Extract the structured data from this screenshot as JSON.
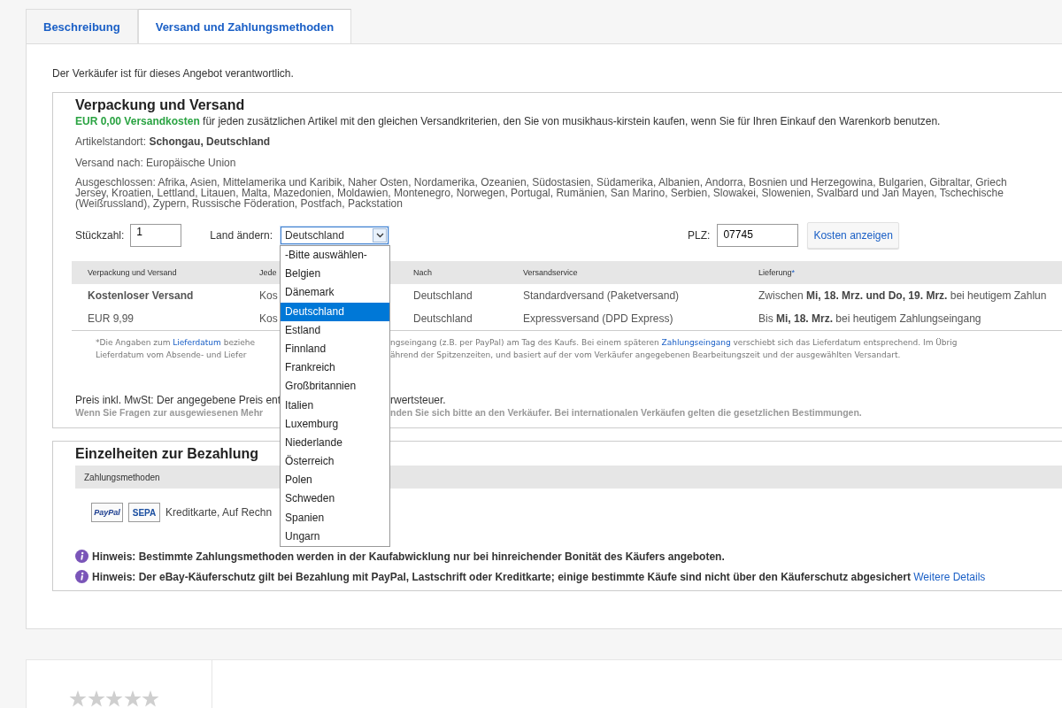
{
  "tabs": [
    {
      "label": "Beschreibung",
      "selected": false
    },
    {
      "label": "Versand und Zahlungsmethoden",
      "selected": true
    }
  ],
  "responsibility": "Der Verkäufer ist für dieses Angebot verantwortlich.",
  "shipping": {
    "title": "Verpackung und Versand",
    "extra_cost": "**EUR 0,00 Versandkosten** für jeden zusätzlichen Artikel mit den gleichen Versandkriterien, den Sie von musikhaus-kirstein kaufen, wenn Sie für Ihren Einkauf den Warenkorb benutzen.",
    "location": "Artikelstandort: **Schongau, Deutschland**",
    "ship_to": "Versand nach: Europäische Union",
    "excluded_lines": [
      "Ausgeschlossen: Afrika, Asien, Mittelamerika und Karibik, Naher Osten, Nordamerika, Ozeanien, Südostasien, Südamerika, Albanien, Andorra, Bosnien und Herzegowina, Bulgarien, Gibraltar, Griech",
      "Jersey, Kroatien, Lettland, Litauen, Malta, Mazedonien, Moldawien, Montenegro, Norwegen, Portugal, Rumänien, San Marino, Serbien, Slowakei, Slowenien, Svalbard und Jan Mayen, Tschechische",
      "(Weißrussland), Zypern, Russische Föderation, Postfach, Packstation"
    ],
    "quantity": {
      "label": "Stückzahl:",
      "value": "1"
    },
    "country": {
      "label": "Land ändern:",
      "value": "Deutschland",
      "expanded": true,
      "options": [
        {
          "label": "-Bitte auswählen-",
          "selected": false
        },
        {
          "label": "Belgien",
          "selected": false
        },
        {
          "label": "Dänemark",
          "selected": false
        },
        {
          "label": "Deutschland",
          "selected": true
        },
        {
          "label": "Estland",
          "selected": false
        },
        {
          "label": "Finnland",
          "selected": false
        },
        {
          "label": "Frankreich",
          "selected": false
        },
        {
          "label": "Großbritannien",
          "selected": false
        },
        {
          "label": "Italien",
          "selected": false
        },
        {
          "label": "Luxemburg",
          "selected": false
        },
        {
          "label": "Niederlande",
          "selected": false
        },
        {
          "label": "Österreich",
          "selected": false
        },
        {
          "label": "Polen",
          "selected": false
        },
        {
          "label": "Schweden",
          "selected": false
        },
        {
          "label": "Spanien",
          "selected": false
        },
        {
          "label": "Ungarn",
          "selected": false
        }
      ]
    },
    "zip": {
      "label": "PLZ:",
      "value": "07745"
    },
    "calc_button": "Kosten anzeigen",
    "table": {
      "columns": [
        {
          "label": "Verpackung und Versand"
        },
        {
          "label": "Jede"
        },
        {
          "label": "Nach"
        },
        {
          "label": "Versandservice"
        },
        {
          "label": "Lieferung",
          "footnote_mark": "*"
        }
      ],
      "rows": [
        {
          "kind": "free",
          "cells": [
            "Kostenloser Versand",
            "Kos",
            "Deutschland",
            "Standardversand (Paketversand)",
            "Zwischen **Mi, 18. Mrz. und Do, 19. Mrz.** bei heutigem Zahlun"
          ]
        },
        {
          "kind": "paid",
          "cells": [
            "EUR 9,99",
            "Kos",
            "Deutschland",
            "Expressversand (DPD Express)",
            "Bis **Mi, 18. Mrz.** bei heutigem Zahlungseingang"
          ]
        }
      ]
    },
    "footnote_lines": [
      {
        "left": [
          {
            "kind": "text",
            "text": "*Die Angaben zum "
          },
          {
            "kind": "link",
            "text": "Lieferdatum"
          },
          {
            "kind": "text",
            "text": " beziehe"
          }
        ],
        "right": [
          {
            "kind": "text",
            "text": "ngseingang (z.B. per PayPal) am Tag des Kaufs. Bei einem späteren "
          },
          {
            "kind": "link",
            "text": "Zahlungseingang"
          },
          {
            "kind": "text",
            "text": " verschiebt sich das Lieferdatum entsprechend. Im Übrig"
          }
        ]
      },
      {
        "left": [
          {
            "kind": "text",
            "text": "Lieferdatum vom Absende- und Liefer"
          }
        ],
        "right": [
          {
            "kind": "text",
            "text": "ährend der Spitzenzeiten, und basiert auf der vom Verkäufer angegebenen Bearbeitungszeit und der ausgewählten Versandart."
          }
        ]
      }
    ],
    "tax": {
      "left": "Preis inkl. MwSt: Der angegebene Preis ent",
      "right": "rwertsteuer."
    },
    "note": {
      "left": "Wenn Sie Fragen zur ausgewiesenen Mehr",
      "right": "nden Sie sich bitte an den Verkäufer. Bei internationalen Verkäufen gelten die gesetzlichen Bestimmungen."
    }
  },
  "payment": {
    "title": "Einzelheiten zur Bezahlung",
    "column": "Zahlungsmethoden",
    "logos": [
      "PayPal",
      "SEPA"
    ],
    "methods": "Kreditkarte, Auf Rechn",
    "hints": [
      {
        "text": "Hinweis: Bestimmte Zahlungsmethoden werden in der Kaufabwicklung nur bei hinreichender Bonität des Käufers angeboten."
      },
      {
        "text": "Hinweis: Der eBay-Käuferschutz gilt bei Bezahlung mit PayPal, Lastschrift oder Kreditkarte; einige bestimmte Käufe sind nicht über den Käuferschutz abgesichert ",
        "link": "Weitere Details"
      }
    ]
  },
  "reviews": {
    "stars": 0
  }
}
